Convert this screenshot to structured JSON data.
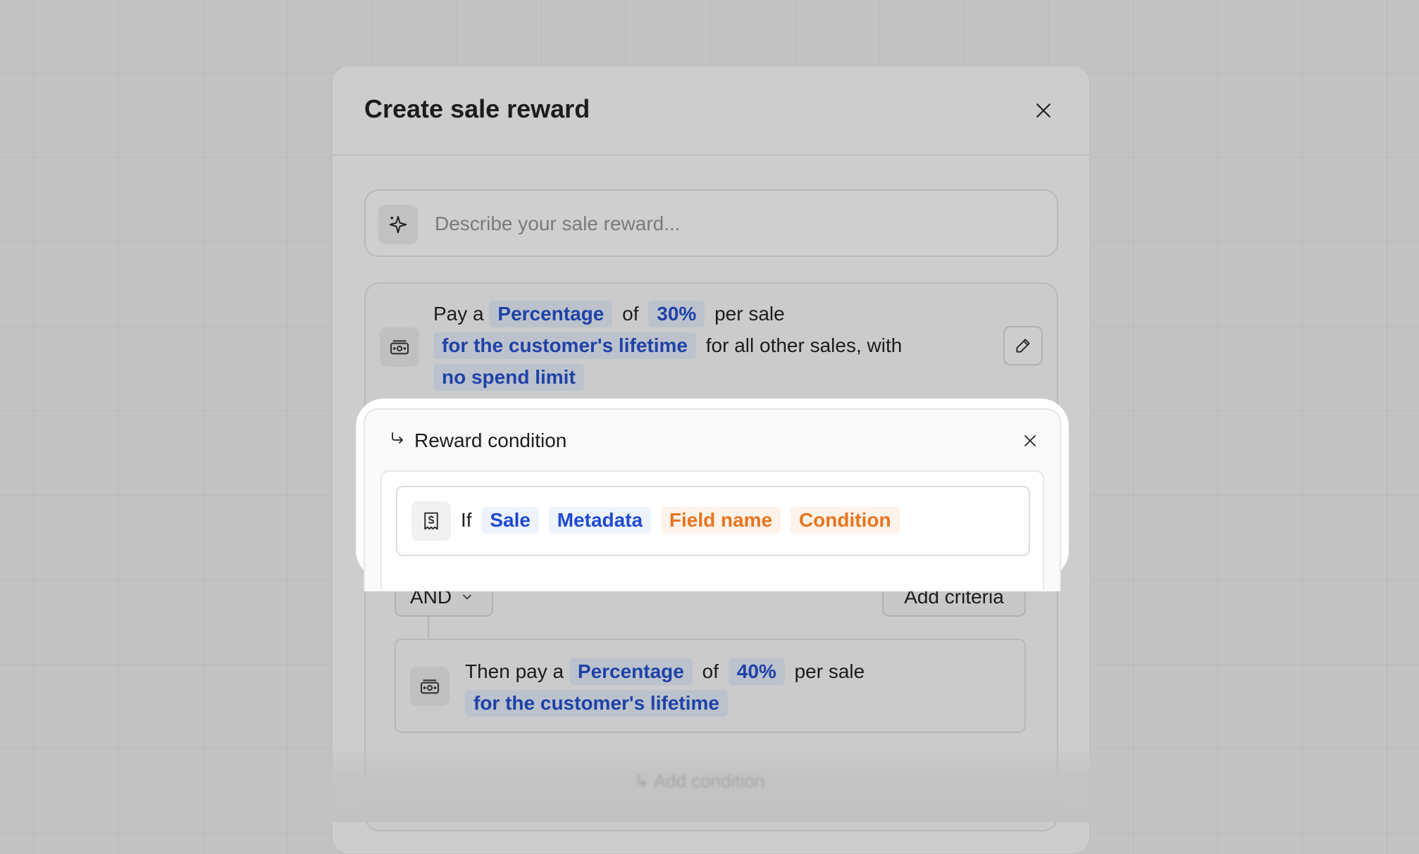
{
  "modal": {
    "title": "Create sale reward"
  },
  "prompt": {
    "placeholder": "Describe your sale reward..."
  },
  "reward": {
    "pay_a": "Pay a",
    "type": "Percentage",
    "of": "of",
    "amount": "30%",
    "per_sale": "per sale",
    "duration": "for the customer's lifetime",
    "scope": "for all other sales, with",
    "limit": "no spend limit"
  },
  "condition": {
    "heading": "Reward condition",
    "if": "If",
    "entity": "Sale",
    "attribute": "Metadata",
    "field": "Field name",
    "operator": "Condition"
  },
  "logic": {
    "operator": "AND",
    "add_criteria": "Add criteria"
  },
  "then": {
    "then_pay_a": "Then pay a",
    "type": "Percentage",
    "of": "of",
    "amount": "40%",
    "per_sale": "per sale",
    "duration": "for the customer's lifetime"
  },
  "footer": {
    "add_condition": "Add condition"
  }
}
